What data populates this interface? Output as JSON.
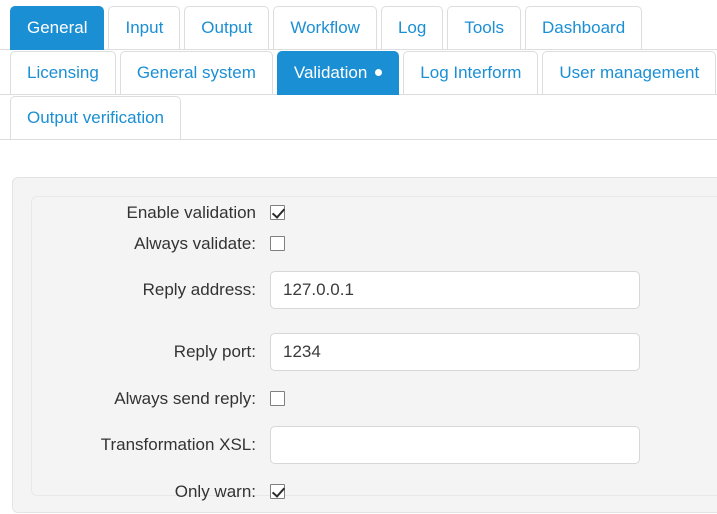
{
  "colors": {
    "accent": "#1b8fd4",
    "tab_text": "#1b8fd4",
    "panel_bg": "#f4f4f4",
    "label_text": "#333333",
    "border": "#dddddd"
  },
  "tabs": {
    "primary": [
      {
        "label": "General",
        "active": true
      },
      {
        "label": "Input",
        "active": false
      },
      {
        "label": "Output",
        "active": false
      },
      {
        "label": "Workflow",
        "active": false
      },
      {
        "label": "Log",
        "active": false
      },
      {
        "label": "Tools",
        "active": false
      },
      {
        "label": "Dashboard",
        "active": false
      }
    ],
    "secondary": [
      {
        "label": "Licensing",
        "active": false,
        "dot": false
      },
      {
        "label": "General system",
        "active": false,
        "dot": false
      },
      {
        "label": "Validation",
        "active": true,
        "dot": true
      },
      {
        "label": "Log Interform",
        "active": false,
        "dot": false
      },
      {
        "label": "User management",
        "active": false,
        "dot": false
      }
    ],
    "tertiary": [
      {
        "label": "Output verification",
        "active": false,
        "dot": false
      }
    ]
  },
  "form": {
    "rows": [
      {
        "label": "Enable validation",
        "type": "checkbox",
        "checked": true
      },
      {
        "label": "Always validate:",
        "type": "checkbox",
        "checked": false
      },
      {
        "label": "Reply address:",
        "type": "text",
        "value": "127.0.0.1",
        "placeholder": ""
      },
      {
        "label": "Reply port:",
        "type": "text",
        "value": "1234",
        "placeholder": ""
      },
      {
        "label": "Always send reply:",
        "type": "checkbox",
        "checked": false
      },
      {
        "label": "Transformation XSL:",
        "type": "text",
        "value": "",
        "placeholder": ""
      },
      {
        "label": "Only warn:",
        "type": "checkbox",
        "checked": true
      }
    ]
  }
}
